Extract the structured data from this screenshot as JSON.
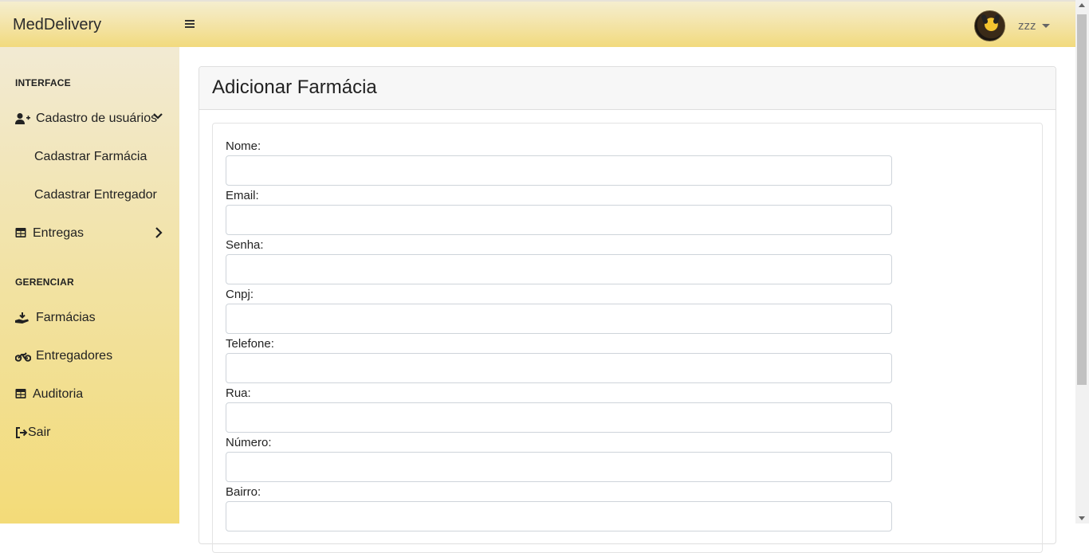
{
  "topbar": {
    "brand": "MedDelivery",
    "toggle_icon": "hamburger-icon",
    "user_name": "zzz"
  },
  "sidebar": {
    "section_interface": "INTERFACE",
    "cadastro": {
      "label": "Cadastro de usuários",
      "icon": "user-plus-icon"
    },
    "sub_farmacia": "Cadastrar Farmácia",
    "sub_entregador": "Cadastrar Entregador",
    "entregas": {
      "label": "Entregas",
      "icon": "table-icon"
    },
    "section_gerenciar": "GERENCIAR",
    "farmacias": {
      "label": "Farmácias",
      "icon": "hand-holding-icon"
    },
    "entregadores": {
      "label": "Entregadores",
      "icon": "motorcycle-icon"
    },
    "auditoria": {
      "label": "Auditoria",
      "icon": "table-icon"
    },
    "sair": {
      "label": "Sair",
      "icon": "sign-out-icon"
    }
  },
  "page": {
    "title": "Adicionar Farmácia",
    "fields": [
      {
        "label": "Nome:",
        "value": ""
      },
      {
        "label": "Email:",
        "value": ""
      },
      {
        "label": "Senha:",
        "value": ""
      },
      {
        "label": "Cnpj:",
        "value": ""
      },
      {
        "label": "Telefone:",
        "value": ""
      },
      {
        "label": "Rua:",
        "value": ""
      },
      {
        "label": "Número:",
        "value": ""
      },
      {
        "label": "Bairro:",
        "value": ""
      }
    ]
  },
  "colors": {
    "sidebar_gradient_top": "#f2ead3",
    "sidebar_gradient_bottom": "#f3db78",
    "header_bg": "#f7f7f7",
    "input_border": "#ced4da"
  }
}
